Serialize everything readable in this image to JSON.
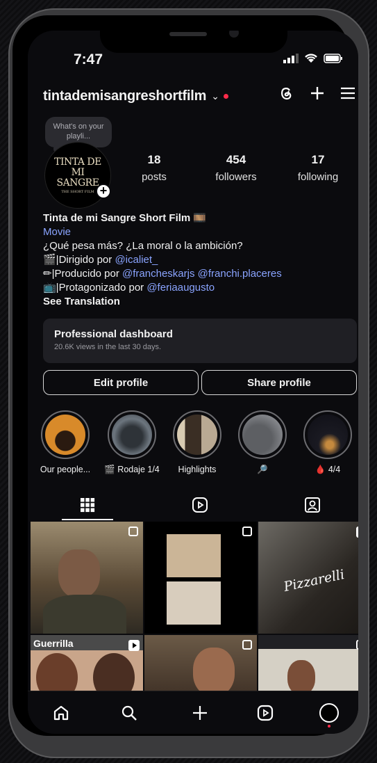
{
  "status": {
    "time": "7:47"
  },
  "header": {
    "username": "tintademisangreshortfilm",
    "chevron": "⌄"
  },
  "note": {
    "text": "What's on your playli..."
  },
  "avatar": {
    "logo_title": "TINTA DE MI SANGRE",
    "logo_sub": "THE SHORT FILM"
  },
  "stats": [
    {
      "value": "18",
      "label": "posts"
    },
    {
      "value": "454",
      "label": "followers"
    },
    {
      "value": "17",
      "label": "following"
    }
  ],
  "bio": {
    "name": "Tinta de mi Sangre Short Film 🎞️",
    "category": "Movie",
    "line1": "¿Qué pesa más? ¿La moral o la ambición?",
    "line2_prefix": "🎬|Dirigido por ",
    "line2_link": "@icaliet_",
    "line3_prefix": "✏|Producido por ",
    "line3_link": "@francheskarjs @franchi.placeres",
    "line4_prefix": "📺|Protagonizado por ",
    "line4_link": "@feriaaugusto",
    "see_translation": "See Translation"
  },
  "dashboard": {
    "title": "Professional dashboard",
    "subtitle": "20.6K views in the last 30 days."
  },
  "buttons": {
    "edit": "Edit profile",
    "share": "Share profile"
  },
  "highlights": [
    {
      "label": "Our people...",
      "color": "#d88a2a"
    },
    {
      "label": "🎬 Rodaje 1/4",
      "color": "#59626c"
    },
    {
      "label": "Highlights",
      "color": "#6e5b45"
    },
    {
      "label": "🔎",
      "color": "#8a8c90"
    },
    {
      "label": "🩸 4/4",
      "color": "#2a2a34"
    }
  ],
  "colors": {
    "accent_link": "#8aa4ff",
    "notification": "#ff2b4a"
  },
  "grid_posts": [
    {
      "type": "carousel"
    },
    {
      "type": "carousel"
    },
    {
      "type": "reel",
      "caption": "Pizzarelli"
    },
    {
      "type": "reel",
      "sign": "Guerrilla"
    },
    {
      "type": "carousel"
    },
    {
      "type": "carousel"
    }
  ],
  "nav": [
    "home-icon",
    "search-icon",
    "create-icon",
    "reels-icon",
    "profile-avatar"
  ]
}
